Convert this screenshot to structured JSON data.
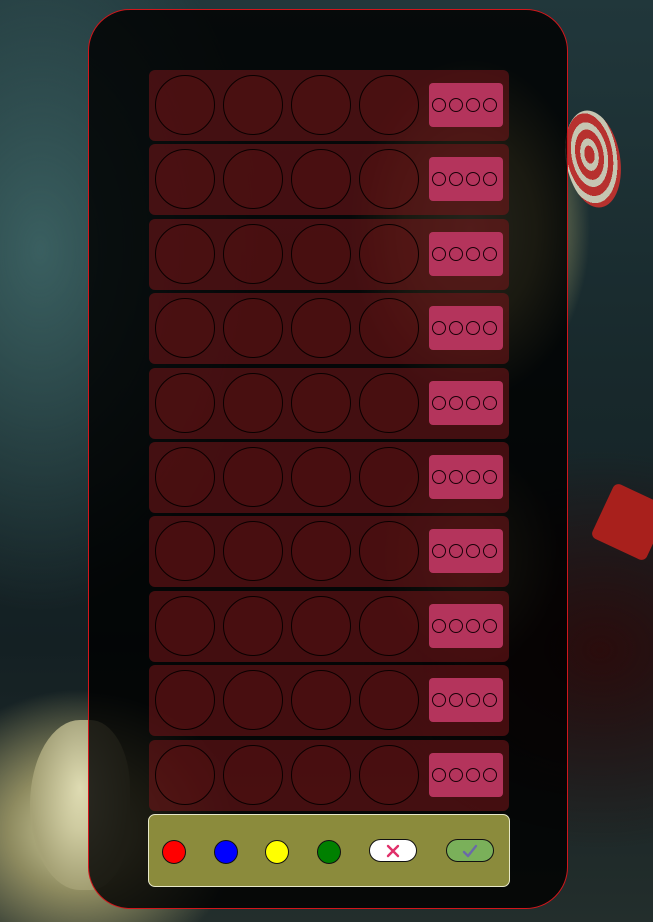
{
  "board": {
    "rows": [
      {
        "pegs": [
          "",
          "",
          "",
          ""
        ],
        "feedback": [
          "",
          "",
          "",
          ""
        ]
      },
      {
        "pegs": [
          "",
          "",
          "",
          ""
        ],
        "feedback": [
          "",
          "",
          "",
          ""
        ]
      },
      {
        "pegs": [
          "",
          "",
          "",
          ""
        ],
        "feedback": [
          "",
          "",
          "",
          ""
        ]
      },
      {
        "pegs": [
          "",
          "",
          "",
          ""
        ],
        "feedback": [
          "",
          "",
          "",
          ""
        ]
      },
      {
        "pegs": [
          "",
          "",
          "",
          ""
        ],
        "feedback": [
          "",
          "",
          "",
          ""
        ]
      },
      {
        "pegs": [
          "",
          "",
          "",
          ""
        ],
        "feedback": [
          "",
          "",
          "",
          ""
        ]
      },
      {
        "pegs": [
          "",
          "",
          "",
          ""
        ],
        "feedback": [
          "",
          "",
          "",
          ""
        ]
      },
      {
        "pegs": [
          "",
          "",
          "",
          ""
        ],
        "feedback": [
          "",
          "",
          "",
          ""
        ]
      },
      {
        "pegs": [
          "",
          "",
          "",
          ""
        ],
        "feedback": [
          "",
          "",
          "",
          ""
        ]
      },
      {
        "pegs": [
          "",
          "",
          "",
          ""
        ],
        "feedback": [
          "",
          "",
          "",
          ""
        ]
      }
    ]
  },
  "palette": {
    "colors": [
      {
        "name": "red",
        "hex": "#ff0000"
      },
      {
        "name": "blue",
        "hex": "#0000ff"
      },
      {
        "name": "yellow",
        "hex": "#ffff00"
      },
      {
        "name": "green",
        "hex": "#008000"
      }
    ],
    "clear_button": {
      "icon": "cross-icon",
      "color": "#e0306a",
      "background": "#ffffff"
    },
    "submit_button": {
      "icon": "checkmark-icon",
      "color": "#6a6aa8",
      "background": "#7ab05a"
    }
  },
  "theme": {
    "board_border": "#d1161b",
    "row_color": "#781619",
    "feedback_color": "#b4345c",
    "palette_color": "#8b8b3c"
  }
}
